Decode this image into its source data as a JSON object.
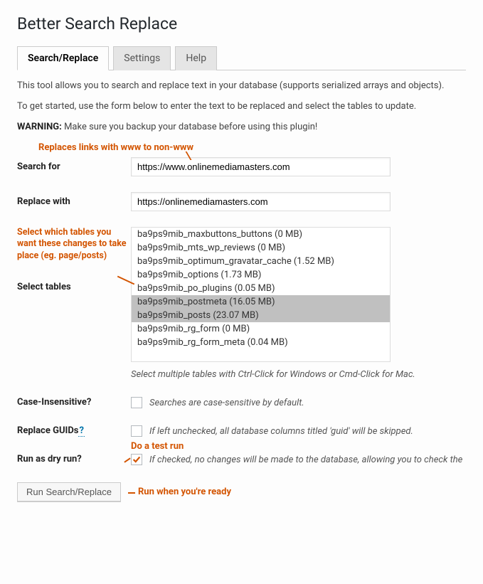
{
  "page_title": "Better Search Replace",
  "tabs": [
    {
      "label": "Search/Replace",
      "active": true
    },
    {
      "label": "Settings",
      "active": false
    },
    {
      "label": "Help",
      "active": false
    }
  ],
  "intro": {
    "line1": "This tool allows you to search and replace text in your database (supports serialized arrays and objects).",
    "line2": "To get started, use the form below to enter the text to be replaced and select the tables to update.",
    "warning_prefix": "WARNING:",
    "warning_text": " Make sure you backup your database before using this plugin!"
  },
  "annotations": {
    "top": "Replaces links with www to non-www",
    "tables": "Select which tables you want these changes to take place (eg. page/posts)",
    "dryrun": "Do a test run",
    "submit": "Run when you're ready"
  },
  "labels": {
    "search_for": "Search for",
    "replace_with": "Replace with",
    "select_tables": "Select tables",
    "case_insensitive": "Case-Insensitive?",
    "replace_guids": "Replace GUIDs",
    "guids_q": "?",
    "dry_run": "Run as dry run?"
  },
  "values": {
    "search_for": "https://www.onlinemediamasters.com",
    "replace_with": "https://onlinemediamasters.com"
  },
  "tables": [
    {
      "name": "ba9ps9mib_maxbuttons_buttons (0 MB)",
      "selected": false
    },
    {
      "name": "ba9ps9mib_mts_wp_reviews (0 MB)",
      "selected": false
    },
    {
      "name": "ba9ps9mib_optimum_gravatar_cache (1.52 MB)",
      "selected": false
    },
    {
      "name": "ba9ps9mib_options (1.73 MB)",
      "selected": false
    },
    {
      "name": "ba9ps9mib_po_plugins (0.05 MB)",
      "selected": false
    },
    {
      "name": "ba9ps9mib_postmeta (16.05 MB)",
      "selected": true
    },
    {
      "name": "ba9ps9mib_posts (23.07 MB)",
      "selected": true
    },
    {
      "name": "ba9ps9mib_rg_form (0 MB)",
      "selected": false
    },
    {
      "name": "ba9ps9mib_rg_form_meta (0.04 MB)",
      "selected": false
    }
  ],
  "tables_hint": "Select multiple tables with Ctrl-Click for Windows or Cmd-Click for Mac.",
  "checkboxes": {
    "case_insensitive": {
      "checked": false,
      "desc": "Searches are case-sensitive by default."
    },
    "replace_guids": {
      "checked": false,
      "desc": "If left unchecked, all database columns titled 'guid' will be skipped."
    },
    "dry_run": {
      "checked": true,
      "desc": "If checked, no changes will be made to the database, allowing you to check the "
    }
  },
  "submit_label": "Run Search/Replace"
}
